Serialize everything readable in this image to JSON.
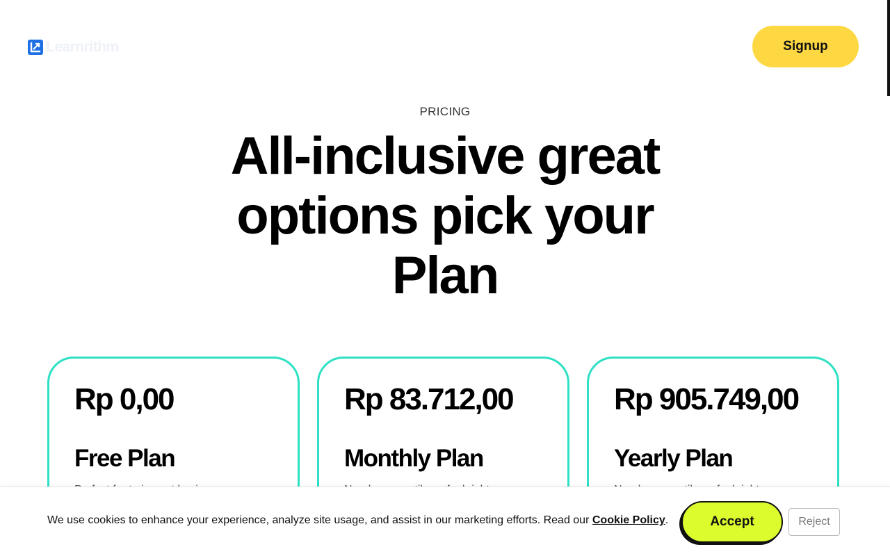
{
  "header": {
    "logo_text": "Learnrithm",
    "signup_label": "Signup"
  },
  "hero": {
    "eyebrow": "PRICING",
    "headline": "All-inclusive great options pick your Plan"
  },
  "plans": [
    {
      "price": "Rp 0,00",
      "name": "Free Plan",
      "description": "Perfect for trying out basic"
    },
    {
      "price": "Rp 83.712,00",
      "name": "Monthly Plan",
      "description": "Need more until you feel right"
    },
    {
      "price": "Rp 905.749,00",
      "name": "Yearly Plan",
      "description": "Need more until you feel right"
    }
  ],
  "cookie": {
    "text": "We use cookies to enhance your experience, analyze site usage, and assist in our marketing efforts. Read our ",
    "link_label": "Cookie Policy",
    "suffix": ".",
    "accept_label": "Accept",
    "reject_label": "Reject"
  },
  "colors": {
    "brand_blue": "#1f6fe5",
    "signup_yellow": "#fdd843",
    "card_border": "#2ee0c4",
    "accept_lime": "#dcfc2e"
  }
}
